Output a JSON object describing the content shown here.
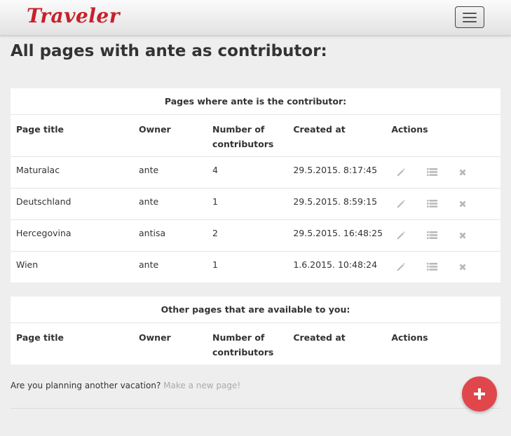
{
  "navbar": {
    "brand": "Traveler",
    "toggle_icon": "hamburger-icon"
  },
  "page_title": "All pages with ante as contributor:",
  "contributor_panel": {
    "title": "Pages where ante is the contributor:",
    "columns": [
      "Page title",
      "Owner",
      "Number of contributors",
      "Created at",
      "Actions"
    ],
    "rows": [
      {
        "title": "Maturalac",
        "owner": "ante",
        "contributors": "4",
        "created": "29.5.2015. 8:17:45"
      },
      {
        "title": "Deutschland",
        "owner": "ante",
        "contributors": "1",
        "created": "29.5.2015. 8:59:15"
      },
      {
        "title": "Hercegovina",
        "owner": "antisa",
        "contributors": "2",
        "created": "29.5.2015. 16:48:25"
      },
      {
        "title": "Wien",
        "owner": "ante",
        "contributors": "1",
        "created": "1.6.2015. 10:48:24"
      }
    ],
    "action_icons": [
      "pencil-icon",
      "list-icon",
      "close-icon"
    ]
  },
  "other_panel": {
    "title": "Other pages that are available to you:",
    "columns": [
      "Page title",
      "Owner",
      "Number of contributors",
      "Created at",
      "Actions"
    ]
  },
  "footer": {
    "text": "Are you planning another vacation?",
    "link": "Make a new page!"
  },
  "fab": {
    "icon": "plus-icon",
    "color": "#e0474c"
  },
  "colors": {
    "brand": "#c8202b",
    "icon_gray": "#b3b3b3",
    "link_gray": "#aaaaaa"
  }
}
